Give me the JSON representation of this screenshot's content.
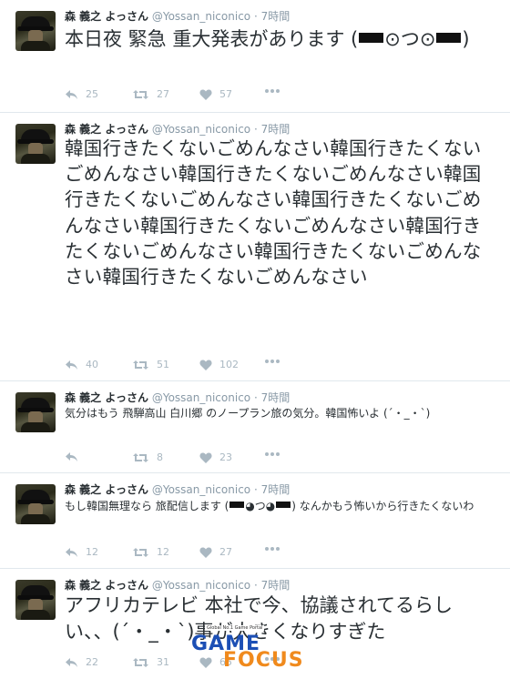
{
  "tweets": [
    {
      "name": "森 義之 よっさん",
      "handle": "@Yossan_niconico",
      "time": "7時間",
      "text_before": "本日夜 緊急 重大発表があります (",
      "text_mid": "⊙つ⊙",
      "text_after": ")",
      "replies": "25",
      "retweets": "27",
      "likes": "57"
    },
    {
      "name": "森 義之 よっさん",
      "handle": "@Yossan_niconico",
      "time": "7時間",
      "text": "韓国行きたくないごめんなさい韓国行きたくないごめんなさい韓国行きたくないごめんなさい韓国行きたくないごめんなさい韓国行きたくないごめんなさい韓国行きたくないごめんなさい韓国行きたくないごめんなさい韓国行きたくないごめんなさい韓国行きたくないごめんなさい",
      "replies": "40",
      "retweets": "51",
      "likes": "102"
    },
    {
      "name": "森 義之 よっさん",
      "handle": "@Yossan_niconico",
      "time": "7時間",
      "text": "気分はもう 飛騨高山 白川郷 のノープラン旅の気分。韓国怖いよ (´・_・`)",
      "replies": "",
      "retweets": "8",
      "likes": "23"
    },
    {
      "name": "森 義之 よっさん",
      "handle": "@Yossan_niconico",
      "time": "7時間",
      "text_before": "もし韓国無理なら 旅配信します (",
      "text_mid": "◕つ◕",
      "text_after": ") なんかもう怖いから行きたくないわ",
      "replies": "12",
      "retweets": "12",
      "likes": "27"
    },
    {
      "name": "森 義之 よっさん",
      "handle": "@Yossan_niconico",
      "time": "7時間",
      "text": "アフリカテレビ 本社で今、協議されてるらしい、、(´・_・`)事が大きくなりすぎた",
      "replies": "22",
      "retweets": "31",
      "likes": "65"
    }
  ],
  "watermark": {
    "tag": "Global No.1 Game Portal",
    "word1": "GAME",
    "word2": "FOCUS"
  },
  "icons": [
    "reply-icon",
    "retweet-icon",
    "like-icon",
    "more-icon"
  ]
}
